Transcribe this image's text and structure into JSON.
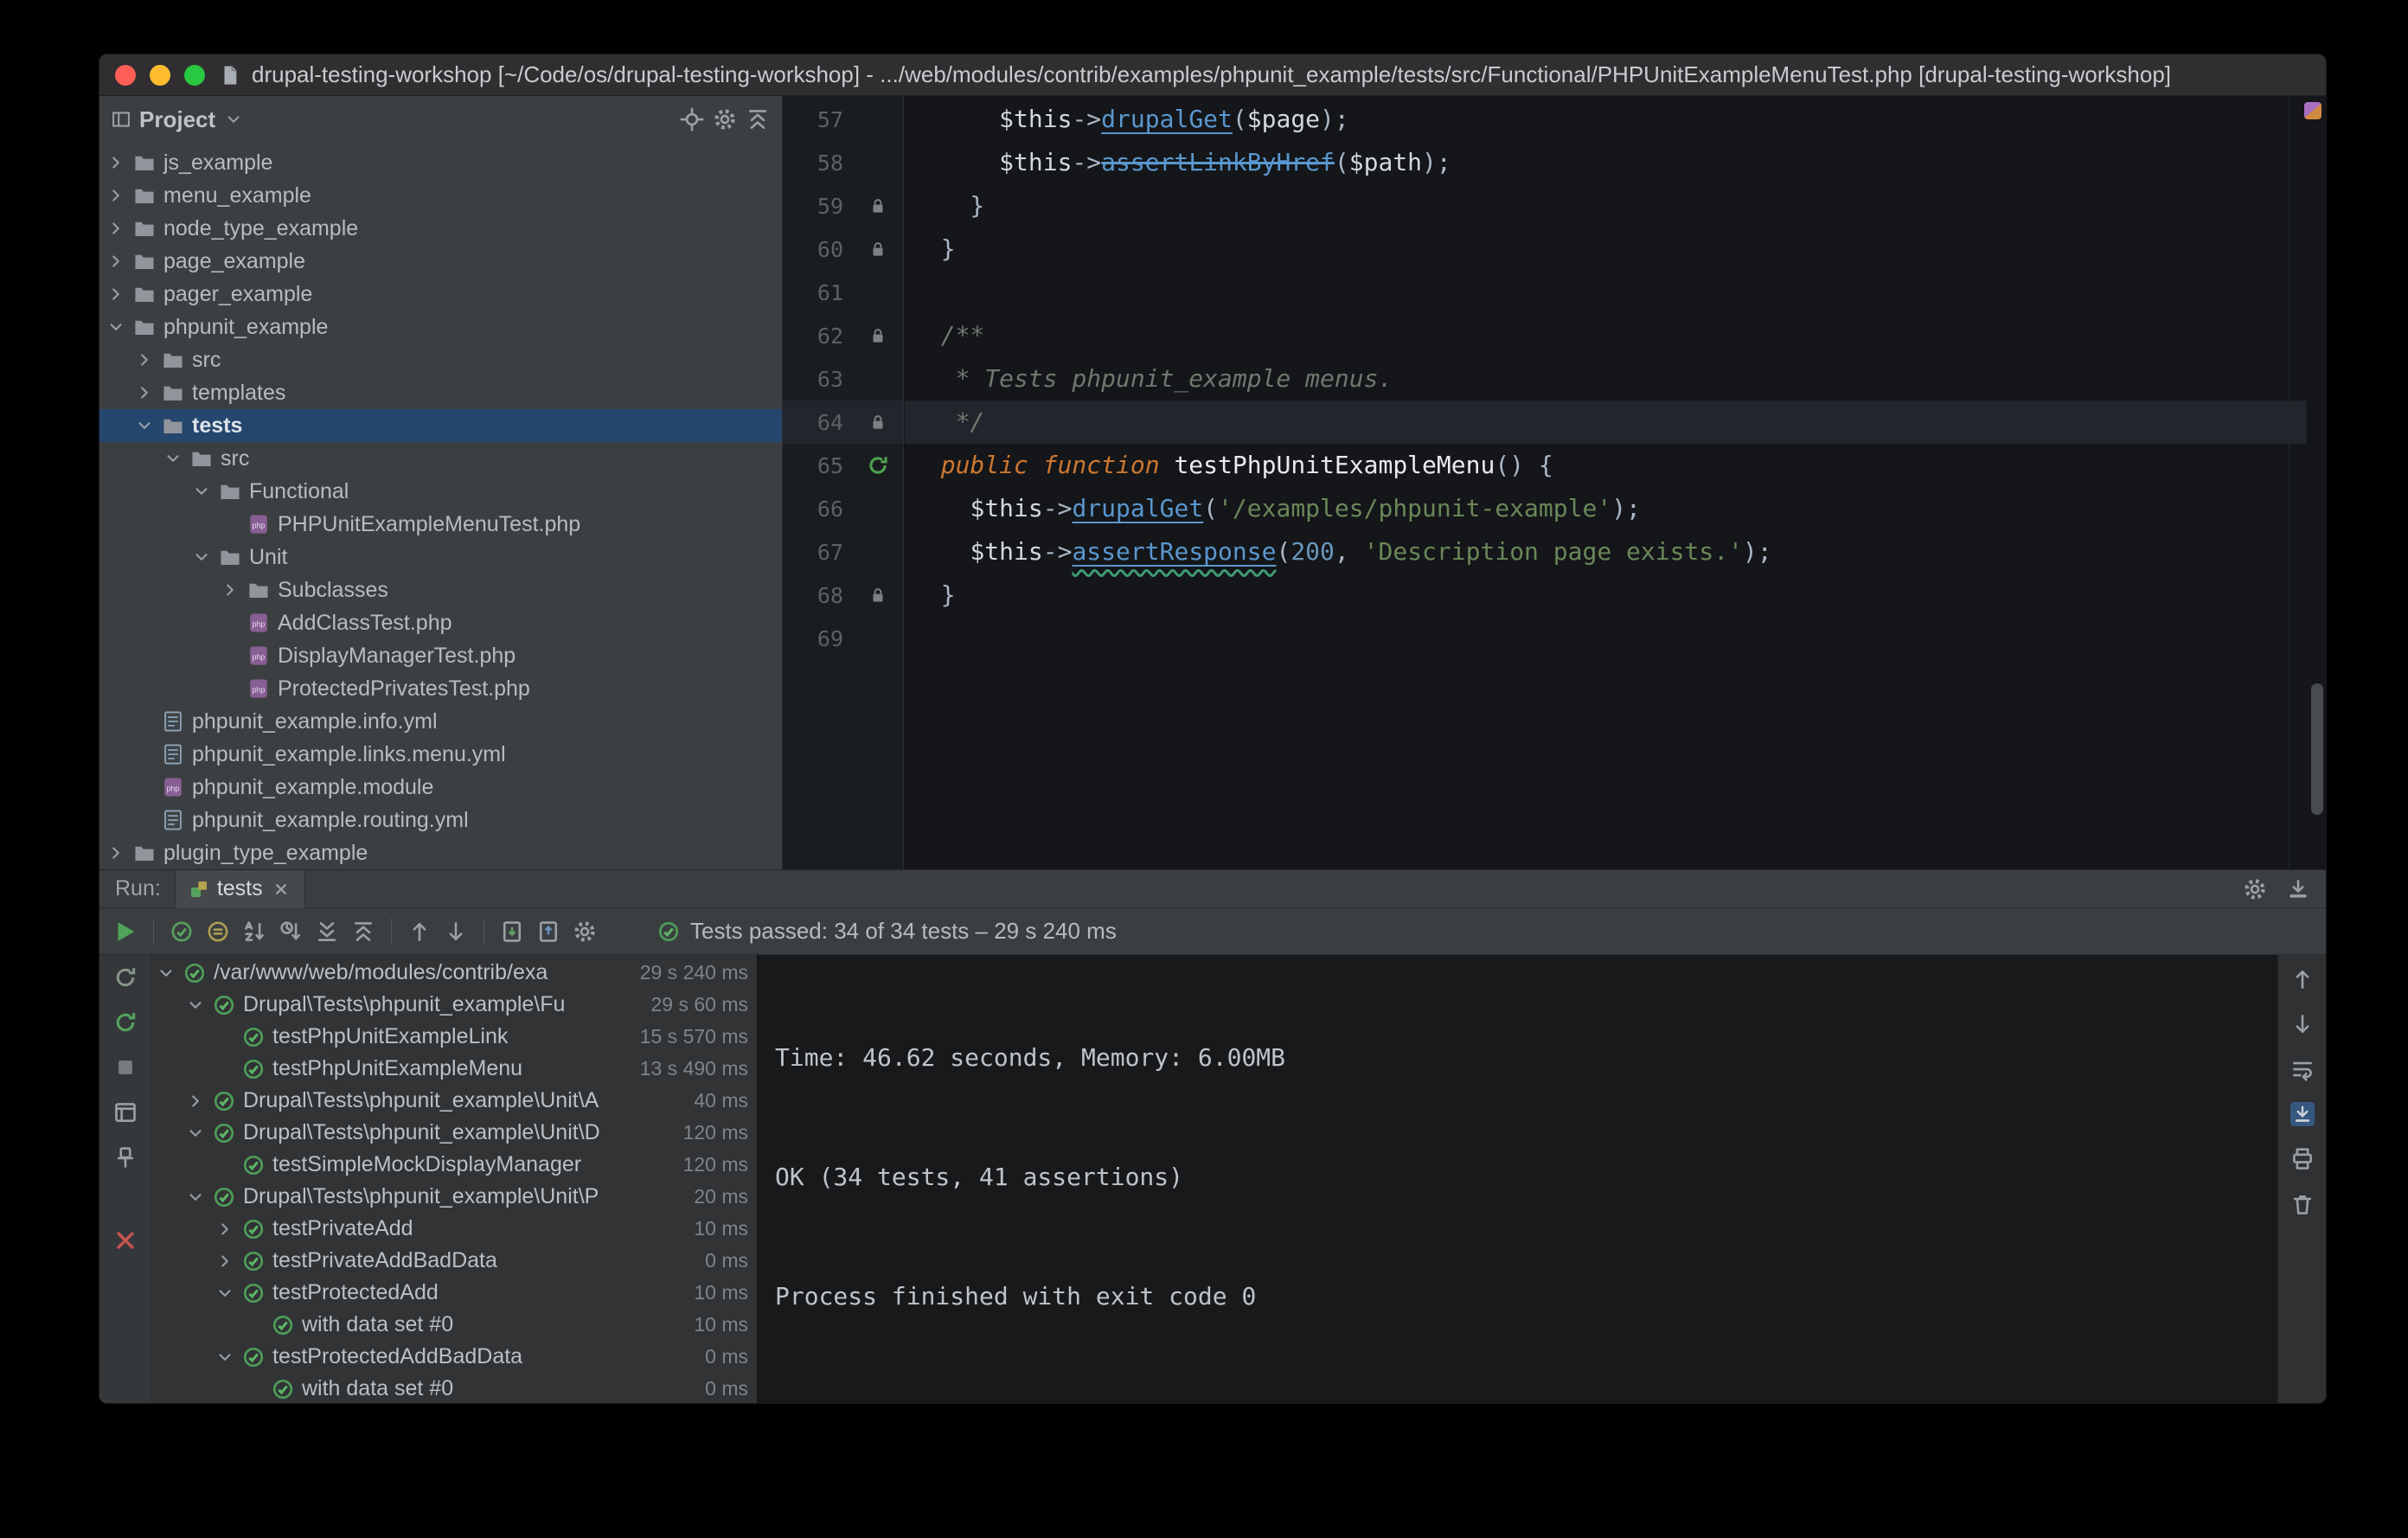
{
  "colors": {
    "selection_blue": "#25466d",
    "pass_green": "#4d9b58",
    "run_green": "#4fa35a",
    "error_red": "#c75450",
    "keyword_orange": "#cc7832",
    "string_green": "#6a8759",
    "method_blue": "#5a97cf"
  },
  "titlebar": {
    "title": "drupal-testing-workshop [~/Code/os/drupal-testing-workshop] - .../web/modules/contrib/examples/phpunit_example/tests/src/Functional/PHPUnitExampleMenuTest.php [drupal-testing-workshop]"
  },
  "project_panel": {
    "header": {
      "title": "Project"
    },
    "tree": [
      {
        "label": "js_example",
        "icon": "folder",
        "level": 0,
        "arrow": "right"
      },
      {
        "label": "menu_example",
        "icon": "folder",
        "level": 0,
        "arrow": "right"
      },
      {
        "label": "node_type_example",
        "icon": "folder",
        "level": 0,
        "arrow": "right"
      },
      {
        "label": "page_example",
        "icon": "folder",
        "level": 0,
        "arrow": "right"
      },
      {
        "label": "pager_example",
        "icon": "folder",
        "level": 0,
        "arrow": "right"
      },
      {
        "label": "phpunit_example",
        "icon": "folder",
        "level": 0,
        "arrow": "down"
      },
      {
        "label": "src",
        "icon": "folder",
        "level": 1,
        "arrow": "right"
      },
      {
        "label": "templates",
        "icon": "folder",
        "level": 1,
        "arrow": "right"
      },
      {
        "label": "tests",
        "icon": "folder",
        "level": 1,
        "arrow": "down",
        "selected": true
      },
      {
        "label": "src",
        "icon": "folder",
        "level": 2,
        "arrow": "down"
      },
      {
        "label": "Functional",
        "icon": "folder",
        "level": 3,
        "arrow": "down"
      },
      {
        "label": "PHPUnitExampleMenuTest.php",
        "icon": "php-file",
        "level": 4,
        "arrow": "none"
      },
      {
        "label": "Unit",
        "icon": "folder",
        "level": 3,
        "arrow": "down"
      },
      {
        "label": "Subclasses",
        "icon": "folder",
        "level": 4,
        "arrow": "right"
      },
      {
        "label": "AddClassTest.php",
        "icon": "php-file",
        "level": 4,
        "arrow": "none"
      },
      {
        "label": "DisplayManagerTest.php",
        "icon": "php-file",
        "level": 4,
        "arrow": "none"
      },
      {
        "label": "ProtectedPrivatesTest.php",
        "icon": "php-file",
        "level": 4,
        "arrow": "none"
      },
      {
        "label": "phpunit_example.info.yml",
        "icon": "yml-file",
        "level": 1,
        "arrow": "none"
      },
      {
        "label": "phpunit_example.links.menu.yml",
        "icon": "yml-file",
        "level": 1,
        "arrow": "none"
      },
      {
        "label": "phpunit_example.module",
        "icon": "php-file",
        "level": 1,
        "arrow": "none"
      },
      {
        "label": "phpunit_example.routing.yml",
        "icon": "yml-file",
        "level": 1,
        "arrow": "none"
      },
      {
        "label": "plugin_type_example",
        "icon": "folder",
        "level": 0,
        "arrow": "right"
      }
    ]
  },
  "editor": {
    "first_line": 57,
    "current_line": 64,
    "lines": [
      {
        "num": 57,
        "gutter": null,
        "tokens": [
          [
            "p",
            "      "
          ],
          [
            "v",
            "$this"
          ],
          [
            "p",
            "->"
          ],
          [
            "m",
            "drupalGet"
          ],
          [
            "p",
            "("
          ],
          [
            "v",
            "$page"
          ],
          [
            "p",
            ");"
          ]
        ]
      },
      {
        "num": 58,
        "gutter": null,
        "tokens": [
          [
            "p",
            "      "
          ],
          [
            "v",
            "$this"
          ],
          [
            "p",
            "->"
          ],
          [
            "md",
            "assertLinkByHref"
          ],
          [
            "p",
            "("
          ],
          [
            "v",
            "$path"
          ],
          [
            "p",
            ");"
          ]
        ]
      },
      {
        "num": 59,
        "gutter": "lock",
        "tokens": [
          [
            "p",
            "    }"
          ]
        ]
      },
      {
        "num": 60,
        "gutter": "lock",
        "tokens": [
          [
            "p",
            "  }"
          ]
        ]
      },
      {
        "num": 61,
        "gutter": null,
        "tokens": []
      },
      {
        "num": 62,
        "gutter": "lock",
        "tokens": [
          [
            "c",
            "  /**"
          ]
        ]
      },
      {
        "num": 63,
        "gutter": null,
        "tokens": [
          [
            "c",
            "   * Tests phpunit_example menus."
          ]
        ]
      },
      {
        "num": 64,
        "gutter": "lock",
        "current": true,
        "tokens": [
          [
            "c",
            "   */"
          ]
        ]
      },
      {
        "num": 65,
        "gutter": "run-test",
        "tokens": [
          [
            "p",
            "  "
          ],
          [
            "k",
            "public function"
          ],
          [
            "p",
            " "
          ],
          [
            "f",
            "testPhpUnitExampleMenu"
          ],
          [
            "p",
            "() {"
          ]
        ]
      },
      {
        "num": 66,
        "gutter": null,
        "tokens": [
          [
            "p",
            "    "
          ],
          [
            "v",
            "$this"
          ],
          [
            "p",
            "->"
          ],
          [
            "m",
            "drupalGet"
          ],
          [
            "p",
            "("
          ],
          [
            "s",
            "'/examples/phpunit-example'"
          ],
          [
            "p",
            ");"
          ]
        ]
      },
      {
        "num": 67,
        "gutter": null,
        "tokens": [
          [
            "p",
            "    "
          ],
          [
            "v",
            "$this"
          ],
          [
            "p",
            "->"
          ],
          [
            "mw",
            "assertResponse"
          ],
          [
            "p",
            "("
          ],
          [
            "n",
            "200"
          ],
          [
            "p",
            ", "
          ],
          [
            "s",
            "'Description page exists.'"
          ],
          [
            "p",
            ");"
          ]
        ]
      },
      {
        "num": 68,
        "gutter": "lock",
        "tokens": [
          [
            "p",
            "  }"
          ]
        ]
      },
      {
        "num": 69,
        "gutter": null,
        "tokens": []
      }
    ]
  },
  "run_panel": {
    "run_label": "Run:",
    "tab": {
      "label": "tests"
    },
    "toolbar_icons": [
      "play",
      "sep",
      "show-passed",
      "show-ignored",
      "sort-alpha",
      "sort-duration",
      "expand-all",
      "collapse-all",
      "sep",
      "arrow-up",
      "arrow-down",
      "sep",
      "export-results",
      "import-results",
      "gear"
    ],
    "status": {
      "text": "Tests passed: 34 of 34 tests – 29 s 240 ms"
    },
    "left_icons": [
      "rerun",
      "rerun-failed",
      "stop",
      "restore-layout",
      "pin",
      "close"
    ],
    "right_icons": [
      "arrow-up",
      "arrow-down",
      "soft-wrap",
      "scroll-end",
      "print",
      "clear-all"
    ],
    "right_active_icon": "scroll-end",
    "tree": [
      {
        "label": "/var/www/web/modules/contrib/exa",
        "duration": "29 s 240 ms",
        "level": 0,
        "arrow": "down"
      },
      {
        "label": "Drupal\\Tests\\phpunit_example\\Fu",
        "duration": "29 s 60 ms",
        "level": 1,
        "arrow": "down"
      },
      {
        "label": "testPhpUnitExampleLink",
        "duration": "15 s 570 ms",
        "level": 2,
        "arrow": "none"
      },
      {
        "label": "testPhpUnitExampleMenu",
        "duration": "13 s 490 ms",
        "level": 2,
        "arrow": "none"
      },
      {
        "label": "Drupal\\Tests\\phpunit_example\\Unit\\A",
        "duration": "40 ms",
        "level": 1,
        "arrow": "right"
      },
      {
        "label": "Drupal\\Tests\\phpunit_example\\Unit\\D",
        "duration": "120 ms",
        "level": 1,
        "arrow": "down"
      },
      {
        "label": "testSimpleMockDisplayManager",
        "duration": "120 ms",
        "level": 2,
        "arrow": "none"
      },
      {
        "label": "Drupal\\Tests\\phpunit_example\\Unit\\P",
        "duration": "20 ms",
        "level": 1,
        "arrow": "down"
      },
      {
        "label": "testPrivateAdd",
        "duration": "10 ms",
        "level": 2,
        "arrow": "right"
      },
      {
        "label": "testPrivateAddBadData",
        "duration": "0 ms",
        "level": 2,
        "arrow": "right"
      },
      {
        "label": "testProtectedAdd",
        "duration": "10 ms",
        "level": 2,
        "arrow": "down"
      },
      {
        "label": "with data set #0",
        "duration": "10 ms",
        "level": 3,
        "arrow": "none"
      },
      {
        "label": "testProtectedAddBadData",
        "duration": "0 ms",
        "level": 2,
        "arrow": "down"
      },
      {
        "label": "with data set #0",
        "duration": "0 ms",
        "level": 3,
        "arrow": "none"
      }
    ],
    "console_lines": [
      "Time: 46.62 seconds, Memory: 6.00MB",
      "OK (34 tests, 41 assertions)",
      "Process finished with exit code 0"
    ]
  }
}
